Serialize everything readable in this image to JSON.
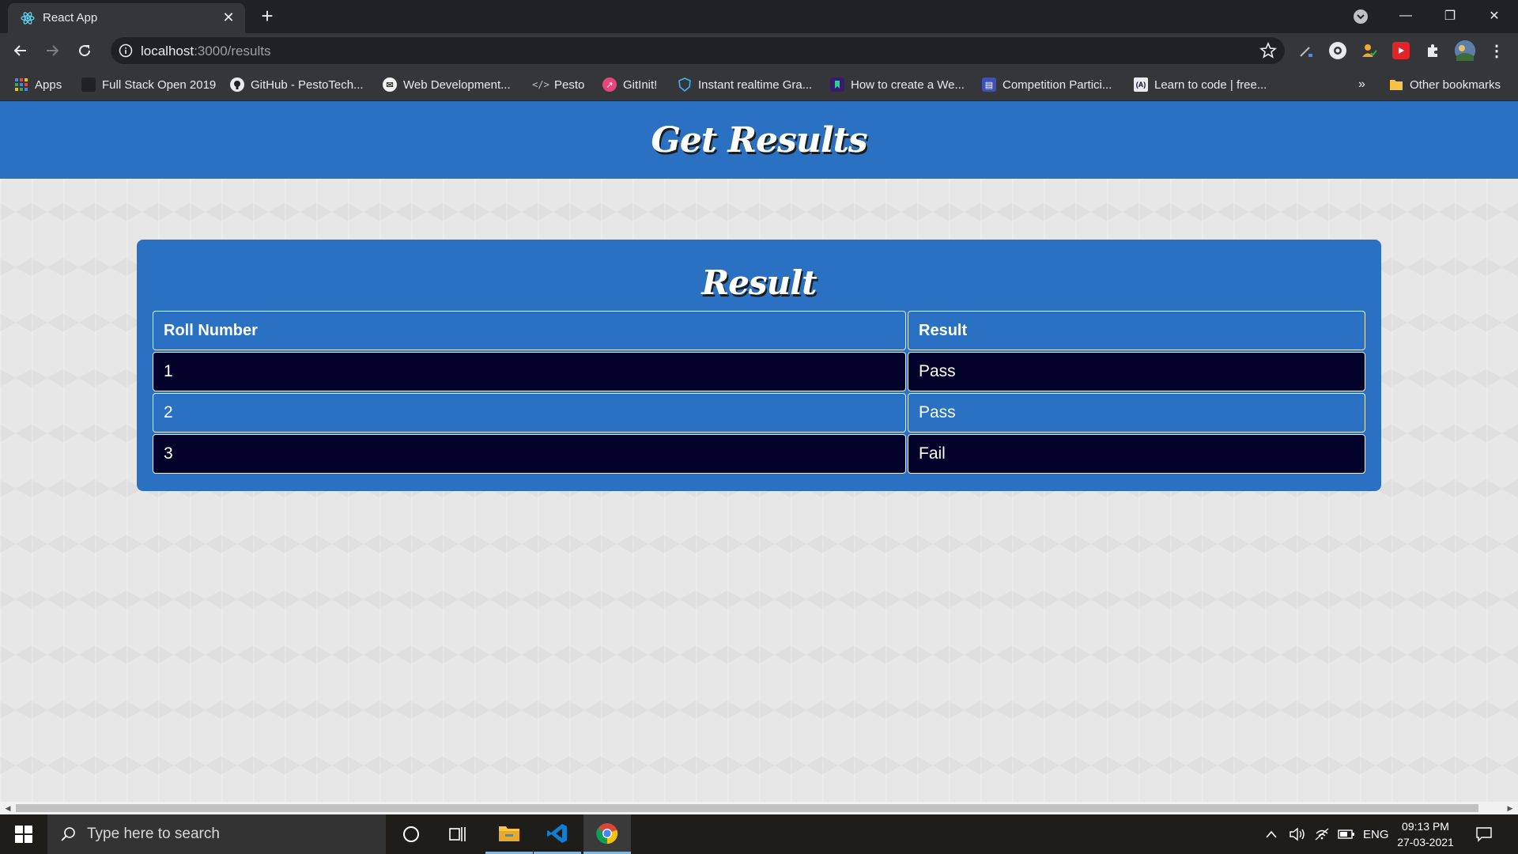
{
  "browser": {
    "tab_title": "React App",
    "url_host": "localhost",
    "url_path": ":3000/results",
    "bookmarks": [
      {
        "label": "Apps",
        "icon": "apps-grid-icon"
      },
      {
        "label": "Full Stack Open 2019",
        "icon": "bookmark-page-icon"
      },
      {
        "label": "GitHub - PestoTech...",
        "icon": "github-icon"
      },
      {
        "label": "Web Development...",
        "icon": "web-dev-icon"
      },
      {
        "label": "Pesto",
        "icon": "code-brackets-icon"
      },
      {
        "label": "GitInit!",
        "icon": "gitinit-icon"
      },
      {
        "label": "Instant realtime Gra...",
        "icon": "shield-icon"
      },
      {
        "label": "How to create a We...",
        "icon": "bookmark-page-icon"
      },
      {
        "label": "Competition Partici...",
        "icon": "calendar-icon"
      },
      {
        "label": "Learn to code | free...",
        "icon": "freecodecamp-icon"
      }
    ],
    "bookmarks_overflow": "»",
    "other_bookmarks": "Other bookmarks"
  },
  "app": {
    "header_title": "Get Results",
    "card_title": "Result",
    "table": {
      "headers": [
        "Roll Number",
        "Result"
      ],
      "rows": [
        [
          "1",
          "Pass"
        ],
        [
          "2",
          "Pass"
        ],
        [
          "3",
          "Fail"
        ]
      ]
    }
  },
  "taskbar": {
    "search_placeholder": "Type here to search",
    "language": "ENG",
    "time": "09:13 PM",
    "date": "27-03-2021"
  },
  "colors": {
    "header_blue": "#2a71c4",
    "dark_row": "#03022b"
  }
}
